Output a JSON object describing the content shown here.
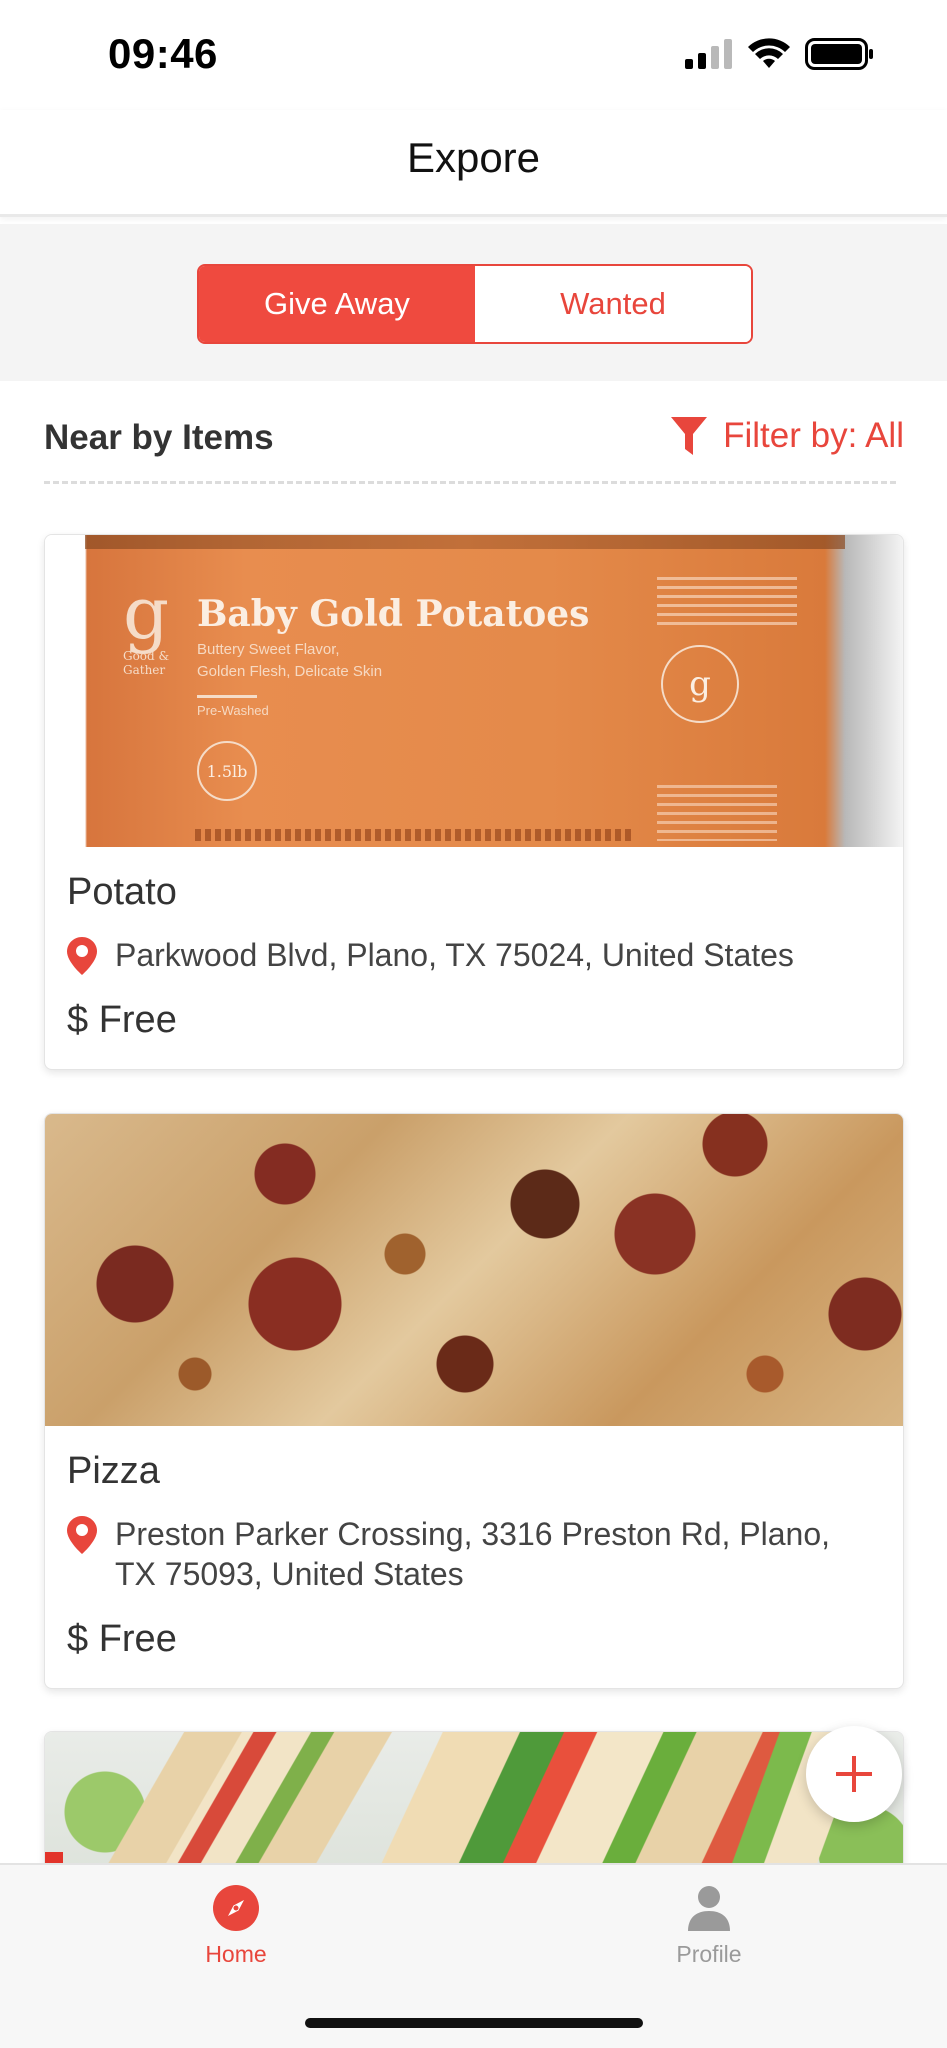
{
  "status_bar": {
    "time": "09:46",
    "icons": [
      "cellular-signal-icon",
      "wifi-icon",
      "battery-icon"
    ]
  },
  "nav": {
    "title": "Expore"
  },
  "segment": {
    "options": [
      "Give Away",
      "Wanted"
    ],
    "selected": "Give Away"
  },
  "section": {
    "title": "Near by Items",
    "filter_label": "Filter by: All",
    "filter_icon": "funnel-icon"
  },
  "items": [
    {
      "name": "Potato",
      "address": "Parkwood Blvd, Plano, TX  75024, United States",
      "price": "$ Free",
      "image_caption": {
        "brand": "Good & Gather",
        "product": "Baby Gold Potatoes",
        "tagline_1": "Buttery Sweet Flavor,",
        "tagline_2": "Golden Flesh, Delicate Skin",
        "note": "Pre-Washed",
        "weight": "1.5lb"
      }
    },
    {
      "name": "Pizza",
      "address": "Preston Parker Crossing, 3316 Preston Rd, Plano, TX  75093, United States",
      "price": "$ Free"
    }
  ],
  "fab": {
    "icon": "plus-icon"
  },
  "tab_bar": {
    "tabs": [
      {
        "label": "Home",
        "icon": "compass-icon",
        "active": true
      },
      {
        "label": "Profile",
        "icon": "person-icon",
        "active": false
      }
    ]
  },
  "colors": {
    "accent": "#ef4a3f",
    "text": "#333333",
    "inactive_tab": "#9a9a9a"
  }
}
